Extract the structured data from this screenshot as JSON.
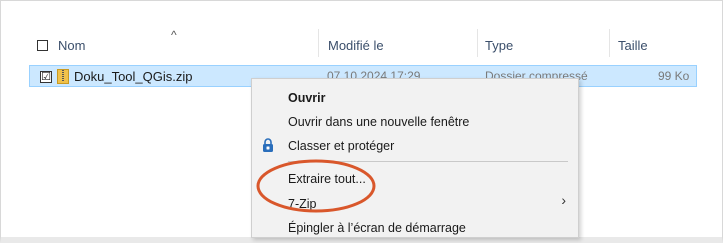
{
  "columns": {
    "name": "Nom",
    "modified": "Modifié le",
    "type": "Type",
    "size": "Taille"
  },
  "sort_indicator": "^",
  "file": {
    "name": "Doku_Tool_QGis.zip",
    "modified": "07.10.2024 17:29",
    "type": "Dossier compressé",
    "size": "99 Ko",
    "checked": "☑",
    "icon": "zip-folder-icon"
  },
  "context_menu": {
    "items": [
      {
        "label": "Ouvrir",
        "bold": true
      },
      {
        "label": "Ouvrir dans une nouvelle fenêtre"
      },
      {
        "label": "Classer et protéger",
        "icon": "lock-shield-icon"
      },
      {
        "label": "Extraire tout..."
      },
      {
        "label": "7-Zip",
        "submenu": true
      },
      {
        "label": "Épingler à l’écran de démarrage"
      }
    ],
    "submenu_arrow": "›"
  },
  "colors": {
    "selection": "#cce8ff",
    "selection_border": "#99d1ff",
    "highlight_oval": "#d9572b",
    "column_text": "#3b4f6b"
  }
}
